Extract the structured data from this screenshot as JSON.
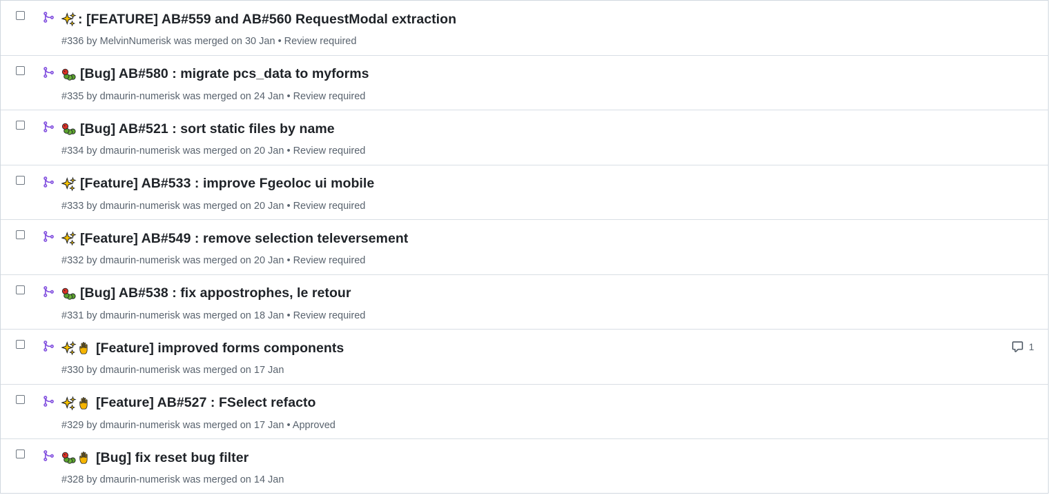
{
  "colors": {
    "merged": "#8250df",
    "text": "#1f2328",
    "muted": "#59636e",
    "border": "#d8dee4"
  },
  "pull_requests": [
    {
      "emojis": [
        "sparkles-icon"
      ],
      "title": ": [FEATURE] AB#559 and AB#560 RequestModal extraction",
      "number": "#336",
      "by": "by",
      "author": "MelvinNumerisk",
      "merged_text": "was merged on 30 Jan",
      "review": "• Review required",
      "comments": null
    },
    {
      "emojis": [
        "bug-icon"
      ],
      "title": "[Bug] AB#580 : migrate pcs_data to myforms",
      "number": "#335",
      "by": "by",
      "author": "dmaurin-numerisk",
      "merged_text": "was merged on 24 Jan",
      "review": "• Review required",
      "comments": null
    },
    {
      "emojis": [
        "bug-icon"
      ],
      "title": "[Bug] AB#521 : sort static files by name",
      "number": "#334",
      "by": "by",
      "author": "dmaurin-numerisk",
      "merged_text": "was merged on 20 Jan",
      "review": "• Review required",
      "comments": null
    },
    {
      "emojis": [
        "sparkles-icon"
      ],
      "title": "[Feature] AB#533 : improve Fgeoloc ui mobile",
      "number": "#333",
      "by": "by",
      "author": "dmaurin-numerisk",
      "merged_text": "was merged on 20 Jan",
      "review": "• Review required",
      "comments": null
    },
    {
      "emojis": [
        "sparkles-icon"
      ],
      "title": "[Feature] AB#549 : remove selection televersement",
      "number": "#332",
      "by": "by",
      "author": "dmaurin-numerisk",
      "merged_text": "was merged on 20 Jan",
      "review": "• Review required",
      "comments": null
    },
    {
      "emojis": [
        "bug-icon"
      ],
      "title": "[Bug] AB#538 : fix appostrophes, le retour",
      "number": "#331",
      "by": "by",
      "author": "dmaurin-numerisk",
      "merged_text": "was merged on 18 Jan",
      "review": "• Review required",
      "comments": null
    },
    {
      "emojis": [
        "sparkles-icon",
        "raised-hand-icon"
      ],
      "title": "[Feature] improved forms components",
      "number": "#330",
      "by": "by",
      "author": "dmaurin-numerisk",
      "merged_text": "was merged on 17 Jan",
      "review": "",
      "comments": "1"
    },
    {
      "emojis": [
        "sparkles-icon",
        "raised-hand-icon"
      ],
      "title": "[Feature] AB#527 : FSelect refacto",
      "number": "#329",
      "by": "by",
      "author": "dmaurin-numerisk",
      "merged_text": "was merged on 17 Jan",
      "review": "• Approved",
      "comments": null
    },
    {
      "emojis": [
        "bug-icon",
        "raised-hand-icon"
      ],
      "title": "[Bug] fix reset bug filter",
      "number": "#328",
      "by": "by",
      "author": "dmaurin-numerisk",
      "merged_text": "was merged on 14 Jan",
      "review": "",
      "comments": null
    }
  ]
}
